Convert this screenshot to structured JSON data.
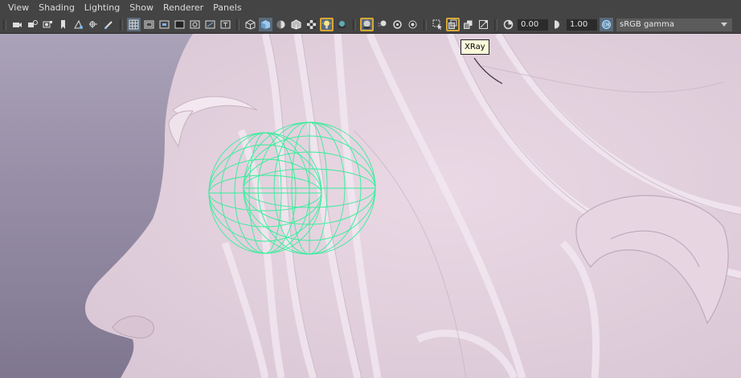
{
  "menubar": {
    "items": [
      "View",
      "Shading",
      "Lighting",
      "Show",
      "Renderer",
      "Panels"
    ]
  },
  "toolbar": {
    "exposure_value": "0.00",
    "gamma_value": "1.00",
    "color_space": "sRGB gamma",
    "icons": {
      "group1": [
        "camera-icon",
        "camera-attributes-icon",
        "bookmark-icon",
        "image-plane-icon",
        "2d-pan-zoom-icon",
        "grease-pencil-icon"
      ],
      "group2": [
        "grid-icon",
        "film-gate-icon",
        "resolution-gate-icon",
        "gate-mask-icon",
        "field-chart-icon",
        "safe-action-icon",
        "safe-title-icon"
      ],
      "group3": [
        "wireframe-icon",
        "smooth-shade-all-icon",
        "use-default-material-icon",
        "wireframe-on-shaded-icon",
        "textured-icon",
        "use-all-lights-icon",
        "shadows-icon"
      ],
      "group4": [
        "screen-space-ambient-occlusion-icon",
        "motion-blur-icon",
        "multisample-anti-aliasing-icon",
        "depth-of-field-icon"
      ],
      "group5": [
        "isolate-select-icon",
        "xray-icon",
        "xray-active-components-icon",
        "xray-joints-icon"
      ],
      "group6": [
        "exposure-icon",
        "gamma-icon",
        "color-management-icon"
      ]
    }
  },
  "tooltip": {
    "text": "XRay"
  },
  "colors": {
    "toolbar_bg": "#444444",
    "highlight_border": "#d8a936",
    "active_toggle": "#596a7a",
    "wireframe": "#33ee99",
    "mesh_pink": "#e6d6e2",
    "background_purple": "#9a90a8"
  }
}
